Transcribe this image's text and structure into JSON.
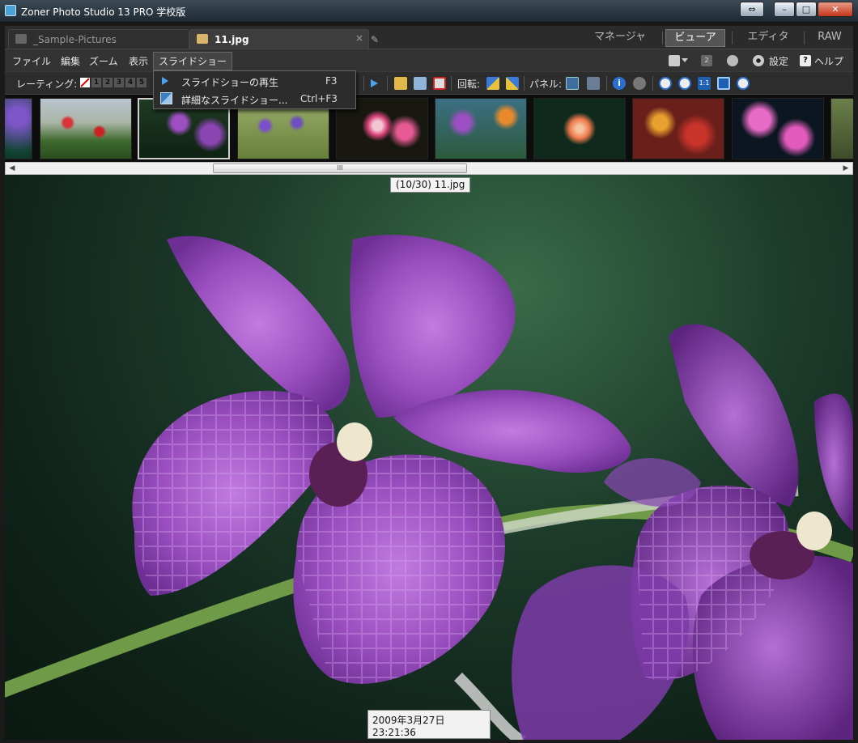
{
  "window": {
    "title": "Zoner Photo Studio 13 PRO 学校版",
    "controls": {
      "resize": "⇔",
      "minimize": "–",
      "maximize": "□",
      "close": "✕"
    }
  },
  "tabs": [
    {
      "label": "_Sample-Pictures",
      "active": false
    },
    {
      "label": "11.jpg",
      "active": true,
      "close": "×"
    }
  ],
  "modes": [
    {
      "label": "マネージャ",
      "active": false
    },
    {
      "label": "ビューア",
      "active": true
    },
    {
      "label": "エディタ",
      "active": false
    },
    {
      "label": "RAW",
      "active": false
    }
  ],
  "menubar": {
    "items": [
      "ファイル",
      "編集",
      "ズーム",
      "表示",
      "スライドショー"
    ],
    "settings": "設定",
    "help": "ヘルプ",
    "help_glyph": "?",
    "monitor_badge": "2"
  },
  "toolbar": {
    "rating_label": "レーティング:",
    "ratings": [
      "1",
      "2",
      "3",
      "4",
      "5"
    ],
    "rotate_label": "回転:",
    "panel_label": "パネル:",
    "info_glyph": "i",
    "fit_glyph": "1:1"
  },
  "slideshow_menu": [
    {
      "label": "スライドショーの再生",
      "shortcut": "F3",
      "icon": "play-icon"
    },
    {
      "label": "詳細なスライドショー...",
      "shortcut": "Ctrl+F3",
      "icon": "slideshow-settings-icon"
    }
  ],
  "filmstrip": {
    "selected_index": 2,
    "scroll_grip": "III",
    "scroll_left": "◀",
    "scroll_right": "▶"
  },
  "viewer": {
    "file_label": "(10/30) 11.jpg",
    "date_label": "2009年3月27日  23:21:36"
  },
  "colors": {
    "accent_blue": "#4aa3f0",
    "orchid": "#9b4fc0",
    "background": "#1a1a1a"
  }
}
